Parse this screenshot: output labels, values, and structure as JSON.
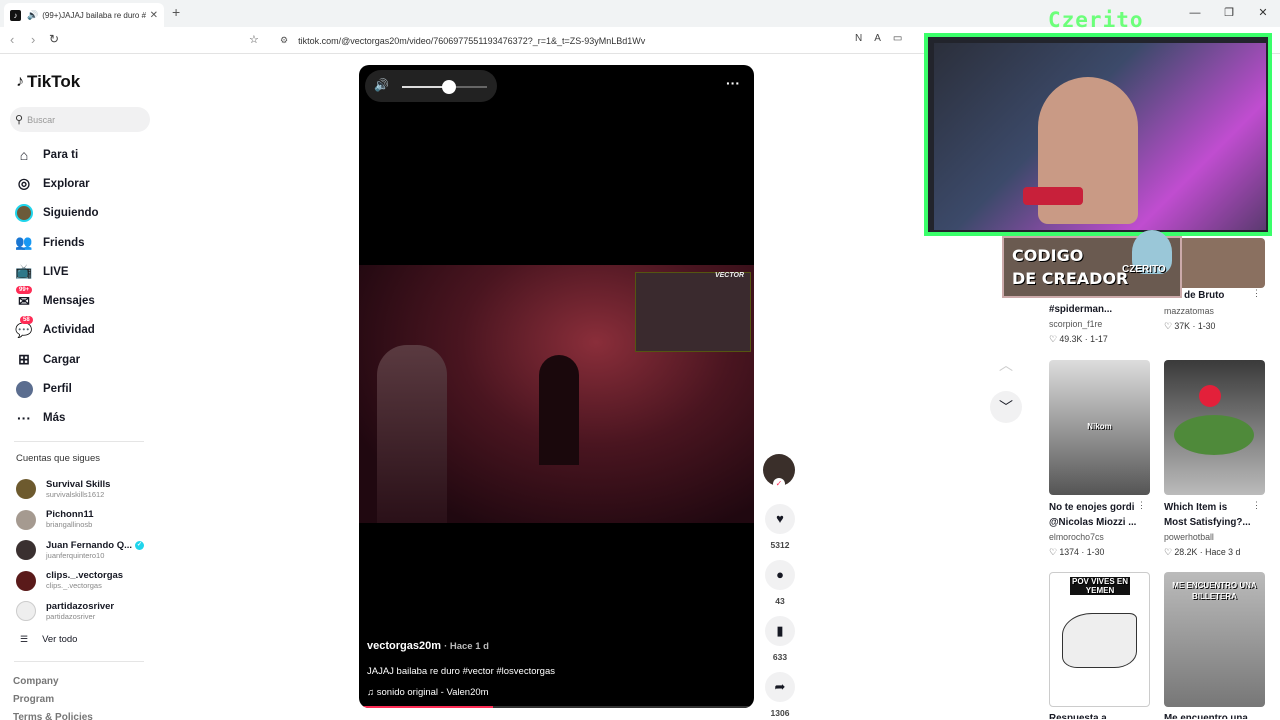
{
  "browser": {
    "tab_title": "(99+)JAJAJ bailaba re duro #...",
    "tab_close": "✕",
    "new_tab": "+",
    "url": "tiktok.com/@vectorgas20m/video/7606977551193476372?_r=1&_t=ZS-93yMnLBd1Wv"
  },
  "sidebar": {
    "logo": "TikTok",
    "search_placeholder": "Buscar",
    "menu": [
      {
        "label": "Para ti",
        "icon": "home-icon"
      },
      {
        "label": "Explorar",
        "icon": "compass-icon"
      },
      {
        "label": "Siguiendo",
        "icon": "following-avatar-icon"
      },
      {
        "label": "Friends",
        "icon": "friends-icon"
      },
      {
        "label": "LIVE",
        "icon": "live-icon"
      },
      {
        "label": "Mensajes",
        "icon": "messages-icon",
        "badge": "99+"
      },
      {
        "label": "Actividad",
        "icon": "activity-icon",
        "badge": "58"
      },
      {
        "label": "Cargar",
        "icon": "upload-icon"
      },
      {
        "label": "Perfil",
        "icon": "profile-icon"
      },
      {
        "label": "Más",
        "icon": "more-icon"
      }
    ],
    "following_title": "Cuentas que sigues",
    "following": [
      {
        "name": "Survival Skills",
        "handle": "survivalskills1612"
      },
      {
        "name": "Pichonn11",
        "handle": "briangallinosb"
      },
      {
        "name": "Juan Fernando Q...",
        "handle": "juanferquintero10",
        "verified": true
      },
      {
        "name": "clips._.vectorgas",
        "handle": "clips._.vectorgas"
      },
      {
        "name": "partidazosriver",
        "handle": "partidazosriver"
      }
    ],
    "see_all": "Ver todo",
    "footer": [
      "Company",
      "Program",
      "Terms & Policies"
    ]
  },
  "video": {
    "volume": 0.55,
    "progress": 0.34,
    "author": "vectorgas20m",
    "time": "· Hace 1 d",
    "description": "JAJAJ bailaba re duro #vector #losvectorgas",
    "sound": "sonido original - Valen20m",
    "overlay_tag": "VECTOR"
  },
  "actions": {
    "likes": "5312",
    "comments": "43",
    "saves": "633",
    "shares": "1306"
  },
  "stream_overlay": {
    "name": "Czerito",
    "code_title_1": "CODIGO",
    "code_title_2": "DE CREADOR",
    "code_name": "CZERITO"
  },
  "recommended": [
    {
      "title": "#spiderman...",
      "author": "scorpion_f1re",
      "likes": "49.3K",
      "date": "1-17"
    },
    {
      "title": "año de Bruto",
      "author": "mazzatomas",
      "likes": "37K",
      "date": "1-30"
    },
    {
      "title": "No te enojes gordi",
      "title2": "@Nicolas Miozzi ...",
      "author": "elmorocho7cs",
      "likes": "1374",
      "date": "1-30",
      "thumb_text": "Nikom"
    },
    {
      "title": "Which Item is",
      "title2": "Most Satisfying?...",
      "author": "powerhotball",
      "likes": "28.2K",
      "date": "Hace 3 d"
    },
    {
      "title": "Respuesta a ...",
      "thumb_text": "POV VIVES EN YEMEN"
    },
    {
      "title": "Me encuentro una ...",
      "thumb_text": "ME ENCUENTRO UNA BILLETERA"
    }
  ],
  "colors": {
    "accent": "#fe2c55",
    "overlay_green": "#3aff6a",
    "verified": "#20d5ec"
  }
}
